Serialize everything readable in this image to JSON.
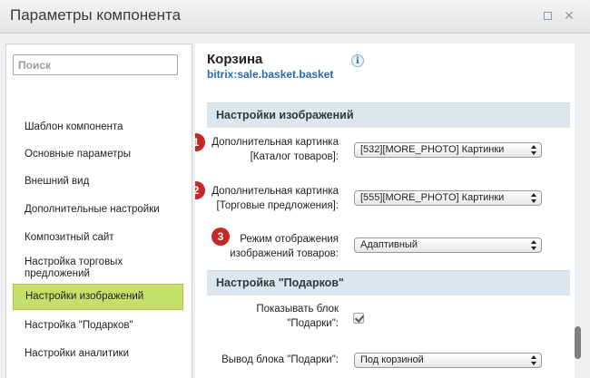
{
  "window": {
    "title": "Параметры компонента",
    "maximize_icon": "maximize-icon",
    "close_icon": "close-icon",
    "close_glyph": "✕"
  },
  "sidebar": {
    "search_placeholder": "Поиск",
    "items": [
      {
        "label": "Шаблон компонента"
      },
      {
        "label": "Основные параметры"
      },
      {
        "label": "Внешний вид"
      },
      {
        "label": "Дополнительные настройки"
      },
      {
        "label": "Композитный сайт"
      },
      {
        "label": "Настройка торговых предложений"
      },
      {
        "label": "Настройки изображений",
        "active": true
      },
      {
        "label": "Настройка \"Подарков\""
      },
      {
        "label": "Настройки аналитики"
      }
    ],
    "active_color": "#c4e06b"
  },
  "component": {
    "title": "Корзина",
    "code": "bitrix:sale.basket.basket",
    "info_glyph": "i"
  },
  "sections": {
    "images": {
      "title": "Настройки изображений",
      "rows": [
        {
          "badge": "1",
          "label_line1": "Дополнительная картинка",
          "label_line2": "[Каталог товаров]:",
          "value": "[532][MORE_PHOTO] Картинки"
        },
        {
          "badge": "2",
          "label_line1": "Дополнительная картинка",
          "label_line2": "[Торговые предложения]:",
          "value": "[555][MORE_PHOTO] Картинки"
        },
        {
          "badge": "3",
          "label_line1": "Режим отображения",
          "label_line2": "изображений товаров:",
          "value": "Адаптивный"
        }
      ]
    },
    "gifts": {
      "title": "Настройка \"Подарков\"",
      "show_block_line1": "Показывать блок",
      "show_block_line2": "\"Подарки\":",
      "show_block_checked": true,
      "output_label": "Вывод блока \"Подарки\":",
      "output_value": "Под корзиной"
    }
  },
  "colors": {
    "badge": "#c62828",
    "link": "#2b6aa6",
    "section_bg": "#dde6ec"
  }
}
